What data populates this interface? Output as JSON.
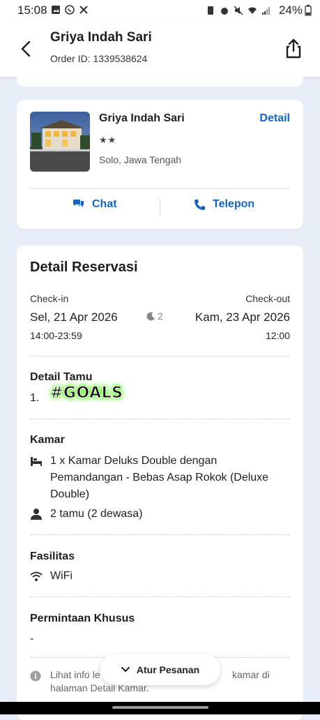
{
  "status_bar": {
    "time": "15:08",
    "battery": "24%"
  },
  "header": {
    "title": "Griya Indah Sari",
    "order_id": "Order ID: 1339538624"
  },
  "hotel_card": {
    "name": "Griya Indah Sari",
    "detail_link": "Detail",
    "stars": "★★",
    "star_rating": 2,
    "location": "Solo, Jawa Tengah",
    "chat_label": "Chat",
    "phone_label": "Telepon"
  },
  "reservation": {
    "title": "Detail Reservasi",
    "checkin_label": "Check-in",
    "checkin_date": "Sel, 21 Apr 2026",
    "checkin_time": "14:00-23:59",
    "nights": "2",
    "checkout_label": "Check-out",
    "checkout_date": "Kam, 23 Apr 2026",
    "checkout_time": "12:00",
    "guest_section_title": "Detail Tamu",
    "guest_index": "1.",
    "guest_name": "#GOALS",
    "room_section_title": "Kamar",
    "room_line1": "1 x Kamar Deluks Double dengan",
    "room_line2": "Pemandangan - Bebas Asap Rokok (Deluxe",
    "room_line3": "Double)",
    "guests": "2 tamu (2 dewasa)",
    "facilities_title": "Fasilitas",
    "facility_wifi": "WiFi",
    "special_request_title": "Permintaan Khusus",
    "special_request_value": "-",
    "info_text_left": "Lihat info le",
    "info_text_right": "kamar di",
    "info_text_line2": "halaman Detail Kamar."
  },
  "fab": {
    "label": "Atur Pesanan"
  },
  "colors": {
    "accent": "#1565c0",
    "background": "#e8eef7"
  }
}
